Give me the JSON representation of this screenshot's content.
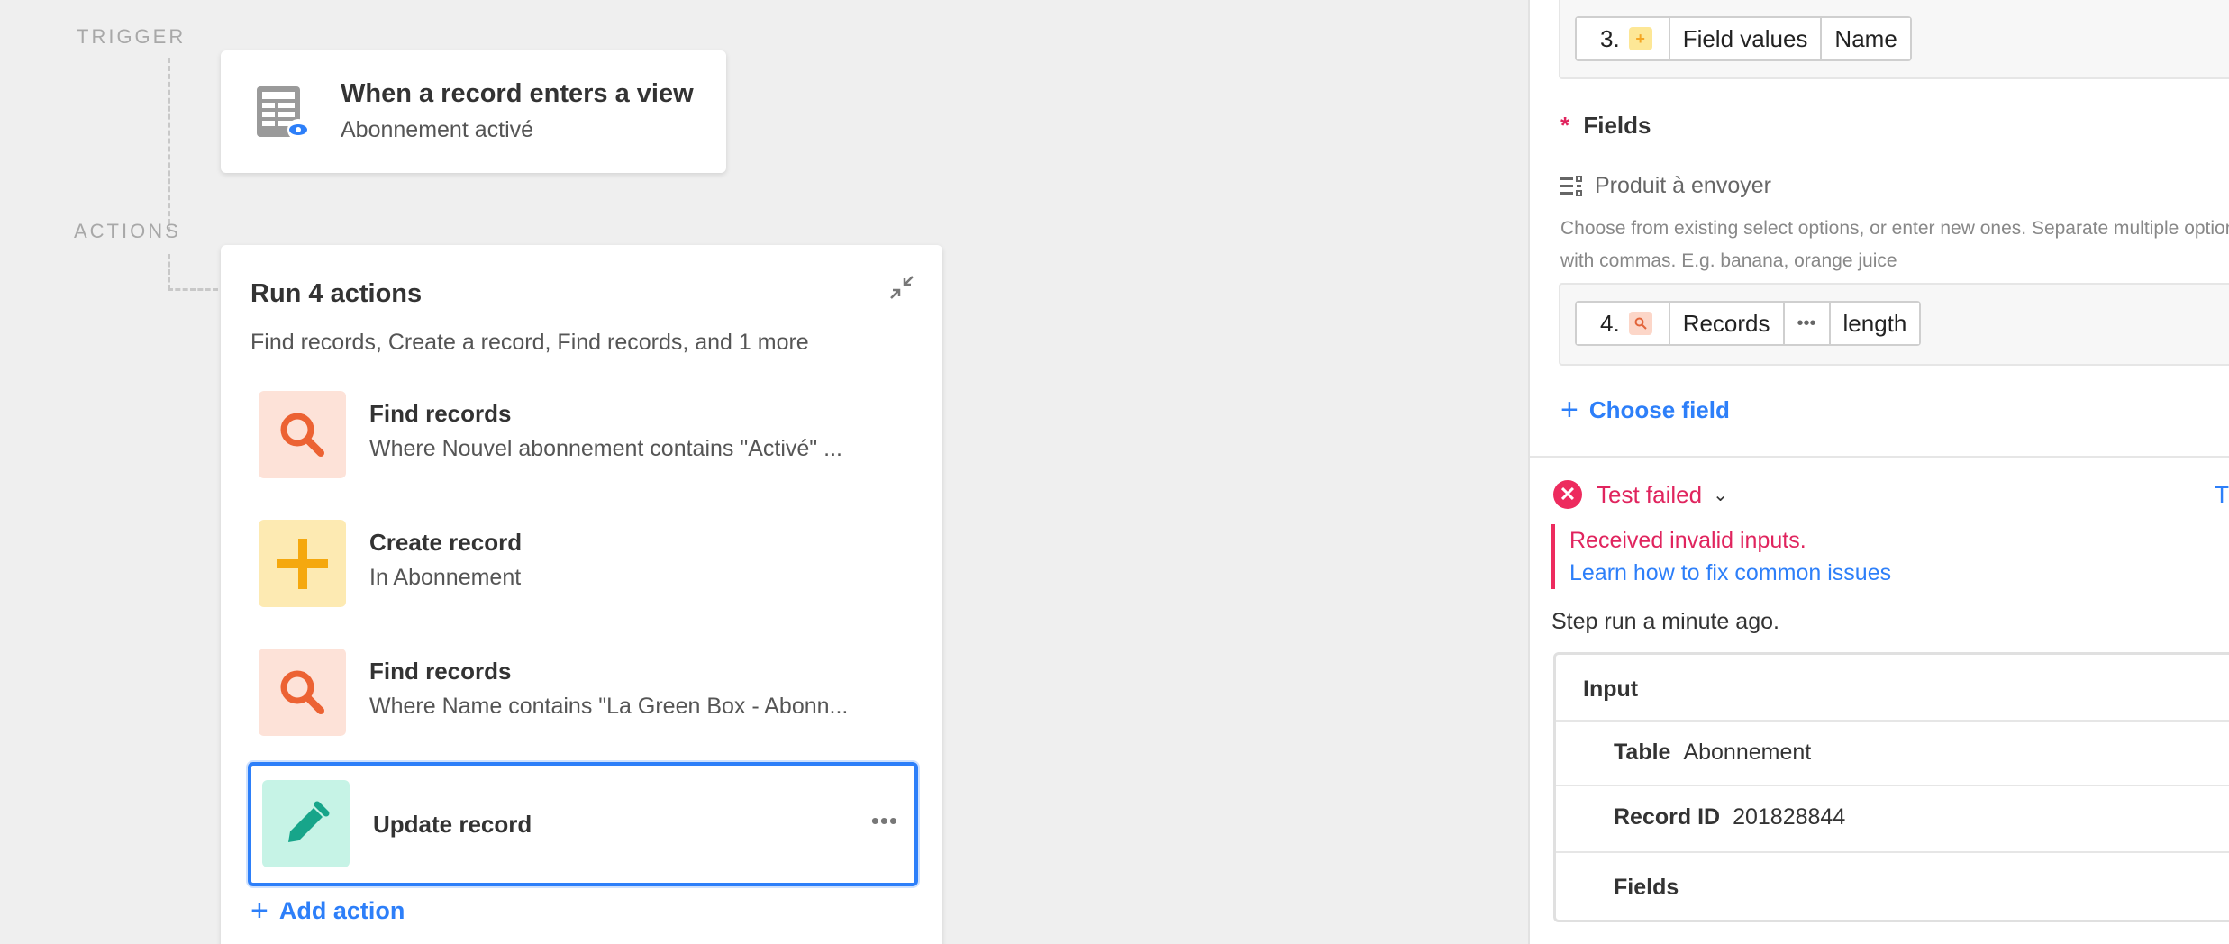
{
  "canvas": {
    "trigger_label": "TRIGGER",
    "actions_label": "ACTIONS",
    "trigger": {
      "title": "When a record enters a view",
      "subtitle": "Abonnement activé",
      "icon": "table-view-icon"
    },
    "actions_group": {
      "title": "Run 4 actions",
      "subtitle": "Find records, Create a record, Find records, and 1 more",
      "items": [
        {
          "title": "Find records",
          "subtitle": "Where Nouvel abonnement contains \"Activé\" ...",
          "icon": "search-icon"
        },
        {
          "title": "Create record",
          "subtitle": "In Abonnement",
          "icon": "plus-icon"
        },
        {
          "title": "Find records",
          "subtitle": "Where Name contains \"La Green Box - Abonn...",
          "icon": "search-icon"
        },
        {
          "title": "Update record",
          "subtitle": "",
          "icon": "pencil-icon"
        }
      ],
      "more_menu": "•••",
      "add_action": "Add action"
    }
  },
  "panel": {
    "token_row_1": {
      "step": "3.",
      "tokens": [
        "Field values",
        "Name"
      ]
    },
    "fields_label": "Fields",
    "required_mark": "*",
    "field_name": "Produit à envoyer",
    "field_help": "Choose from existing select options, or enter new ones. Separate multiple options with commas. E.g. banana, orange juice",
    "token_row_2": {
      "step": "4.",
      "tokens": [
        "Records",
        "•••",
        "length"
      ]
    },
    "choose_field": "Choose field",
    "test_status": "Test failed",
    "test_edge": "T",
    "error_message": "Received invalid inputs.",
    "error_link": "Learn how to fix common issues",
    "step_run": "Step run a minute ago.",
    "input": {
      "heading": "Input",
      "rows": [
        {
          "key": "Table",
          "value": "Abonnement"
        },
        {
          "key": "Record ID",
          "value": "201828844"
        },
        {
          "key": "Fields",
          "value": ""
        }
      ]
    }
  },
  "colors": {
    "accent": "#2d7ff9",
    "error": "#e0245e",
    "find_tile": "#fde2d8",
    "create_tile": "#fdeab2",
    "update_tile": "#c6f3e6"
  }
}
